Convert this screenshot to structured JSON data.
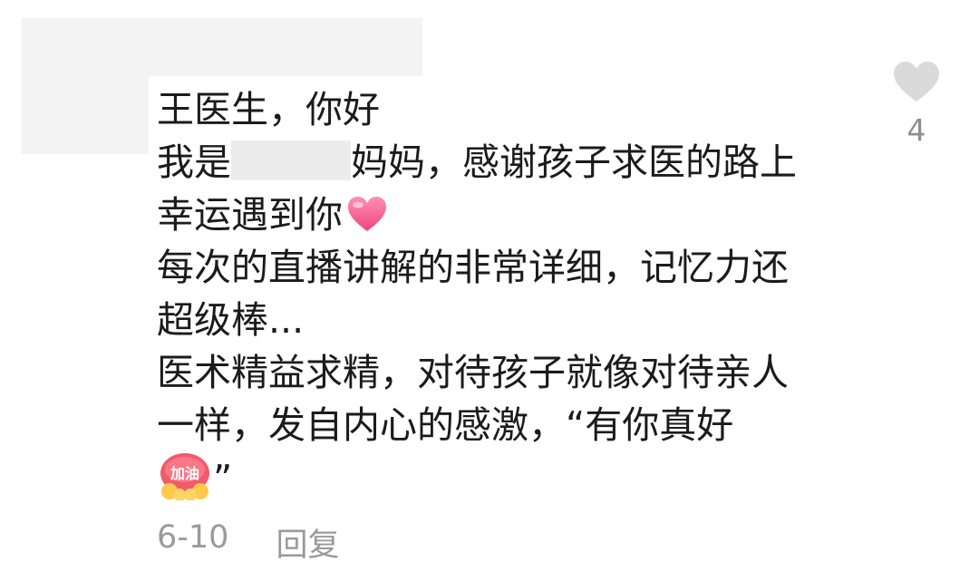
{
  "comment": {
    "lines": {
      "l1": "王医生，你好",
      "l2_before": "我是",
      "l2_after": "妈妈，感谢孩子求医的路上",
      "l3": "幸运遇到你",
      "l4": "每次的直播讲解的非常详细，记忆力还",
      "l5": "超级棒...",
      "l6": "医术精益求精，对待孩子就像对待亲人",
      "l7": "一样，发自内心的感激，“有你真好",
      "l8_tail": "”"
    },
    "emoji_heart_icon": "pink-heart-icon",
    "emoji_jiayou_icon": "jiayou-sticker-icon",
    "emoji_jiayou_text": "加油"
  },
  "meta": {
    "date": "6-10",
    "reply_label": "回复"
  },
  "like": {
    "icon": "heart-outline-icon",
    "count": "4",
    "color": "#dadada"
  }
}
